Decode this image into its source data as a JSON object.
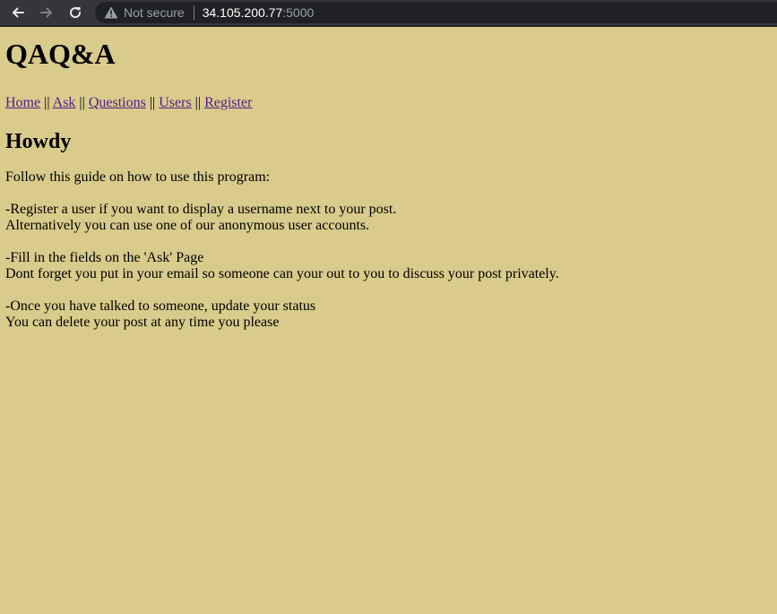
{
  "browser": {
    "security_label": "Not secure",
    "url_host": "34.105.200.77",
    "url_port": ":5000"
  },
  "site": {
    "title": "QAQ&A"
  },
  "nav": {
    "separator": " || ",
    "links": [
      {
        "label": "Home"
      },
      {
        "label": "Ask"
      },
      {
        "label": "Questions"
      },
      {
        "label": "Users"
      },
      {
        "label": "Register"
      }
    ]
  },
  "content": {
    "heading": "Howdy",
    "intro": "Follow this guide on how to use this program:",
    "step1_line1": "-Register a user if you want to display a username next to your post.",
    "step1_line2": "Alternatively you can use one of our anonymous user accounts.",
    "step2_line1": "-Fill in the fields on the 'Ask' Page",
    "step2_line2": "Dont forget you put in your email so someone can your out to you to discuss your post privately.",
    "step3_line1": "-Once you have talked to someone, update your status",
    "step3_line2": "You can delete your post at any time you please"
  },
  "colors": {
    "page_background": "#d8cb8b",
    "link": "#551a8b",
    "browser_bar": "#35363a"
  }
}
